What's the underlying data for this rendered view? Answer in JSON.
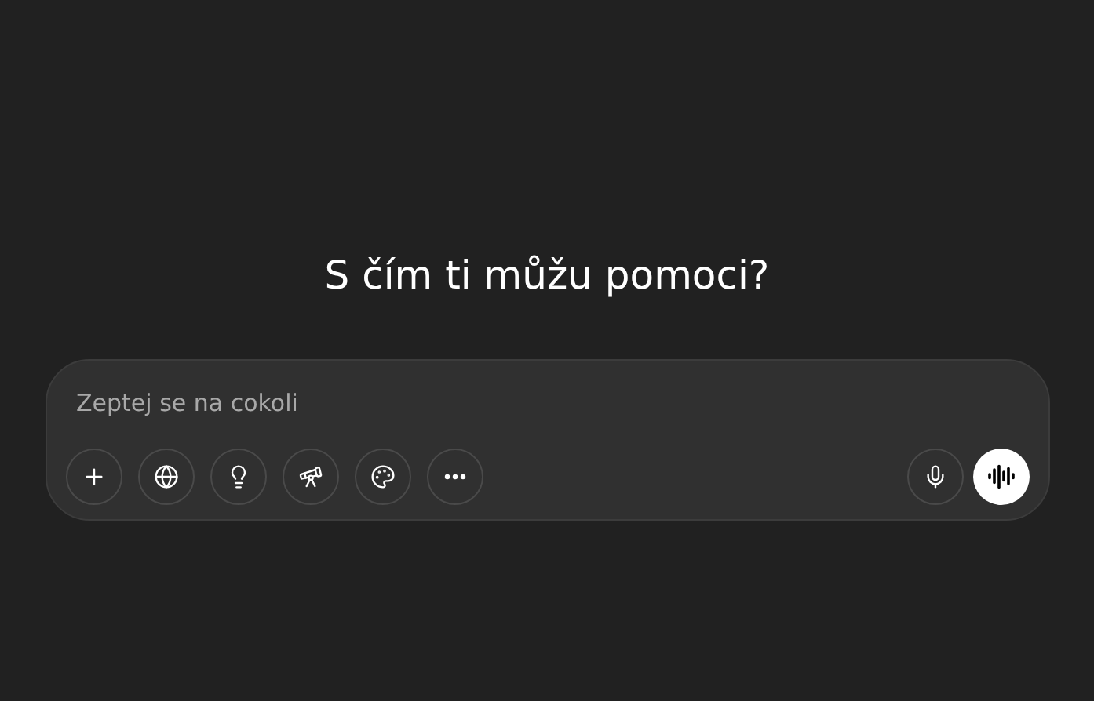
{
  "heading": "S čím ti můžu pomoci?",
  "composer": {
    "placeholder": "Zeptej se na cokoli",
    "tools": [
      {
        "kind": "add"
      },
      {
        "kind": "web"
      },
      {
        "kind": "think"
      },
      {
        "kind": "research"
      },
      {
        "kind": "image"
      },
      {
        "kind": "more"
      }
    ],
    "actions": [
      {
        "kind": "dictate"
      },
      {
        "kind": "voice"
      }
    ]
  }
}
